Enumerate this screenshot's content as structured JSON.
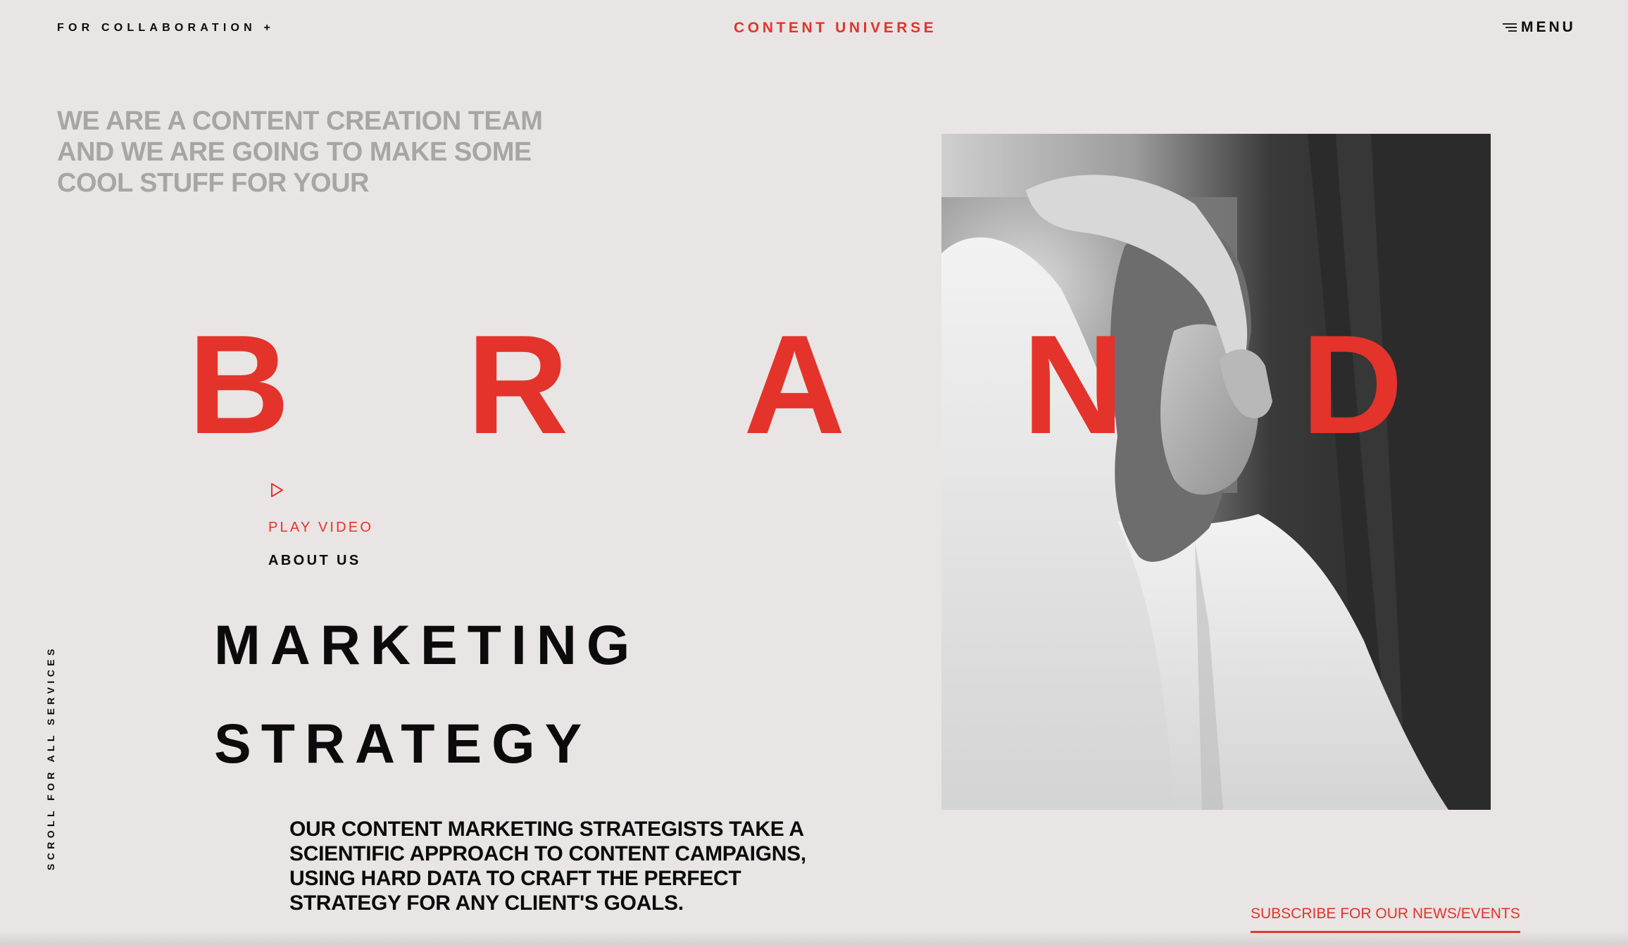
{
  "header": {
    "collaboration": "FOR COLLABORATION +",
    "site_title": "CONTENT UNIVERSE",
    "menu_label": "MENU",
    "menu_icon": "menu-lines-icon"
  },
  "intro_text": "WE ARE A CONTENT CREATION TEAM AND WE ARE GOING TO MAKE SOME COOL STUFF FOR YOUR",
  "brand_word": {
    "letters": [
      "B",
      "R",
      "A",
      "N",
      "D"
    ]
  },
  "video": {
    "icon": "play-icon",
    "label": "PLAY VIDEO"
  },
  "about_label": "ABOUT US",
  "headline": {
    "line1": "MARKETING",
    "line2": "STRATEGY"
  },
  "description": "OUR CONTENT MARKETING STRATEGISTS TAKE A SCIENTIFIC APPROACH TO CONTENT CAMPAIGNS, USING HARD DATA TO CRAFT THE PERFECT STRATEGY FOR ANY CLIENT'S GOALS.",
  "scroll_hint": "SCROLL FOR ALL SERVICES",
  "subscribe_label": "SUBSCRIBE FOR OUR NEWS/EVENTS",
  "colors": {
    "background": "#e8e5e4",
    "accent": "#e4332a",
    "text": "#0b0b0b",
    "muted": "#a8a5a4"
  }
}
